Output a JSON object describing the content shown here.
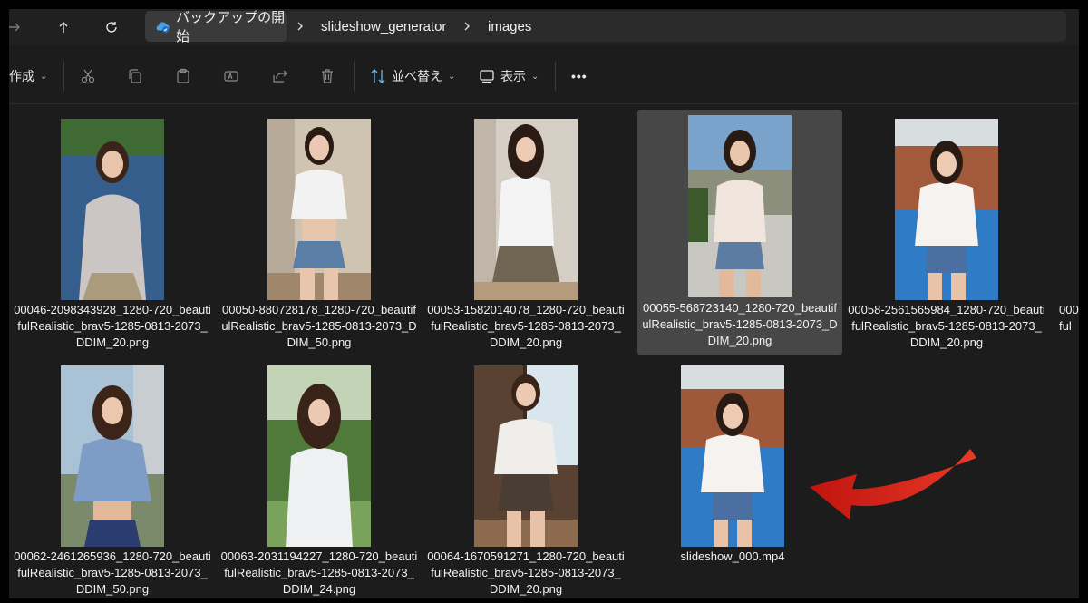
{
  "breadcrumb": {
    "home_label": "バックアップの開始",
    "folders": [
      "slideshow_generator",
      "images"
    ]
  },
  "toolbar": {
    "new_label": "作成",
    "sort_label": "並べ替え",
    "view_label": "表示",
    "more_label": "•••"
  },
  "files": [
    {
      "name": "00046-2098343928_1280-720_beauti\nfulRealistic_brav5-1285-0813-2073_\nDDIM_20.png"
    },
    {
      "name": "00050-880728178_1280-720_beautif\nulRealistic_brav5-1285-0813-2073_D\nDIM_50.png"
    },
    {
      "name": "00053-1582014078_1280-720_beauti\nfulRealistic_brav5-1285-0813-2073_\nDDIM_20.png"
    },
    {
      "name": "00055-568723140_1280-720_beautif\nulRealistic_brav5-1285-0813-2073_D\nDIM_20.png"
    },
    {
      "name": "00058-2561565984_1280-720_beauti\nfulRealistic_brav5-1285-0813-2073_\nDDIM_20.png"
    },
    {
      "name": "00062-2461265936_1280-720_beauti\nfulRealistic_brav5-1285-0813-2073_\nDDIM_50.png"
    },
    {
      "name": "00063-2031194227_1280-720_beauti\nfulRealistic_brav5-1285-0813-2073_\nDDIM_24.png"
    },
    {
      "name": "00064-1670591271_1280-720_beauti\nfulRealistic_brav5-1285-0813-2073_\nDDIM_20.png"
    },
    {
      "name": "slideshow_000.mp4"
    }
  ],
  "colors": {
    "background": "#1c1c1c",
    "selection": "#474747",
    "arrow": "#d8201a"
  }
}
